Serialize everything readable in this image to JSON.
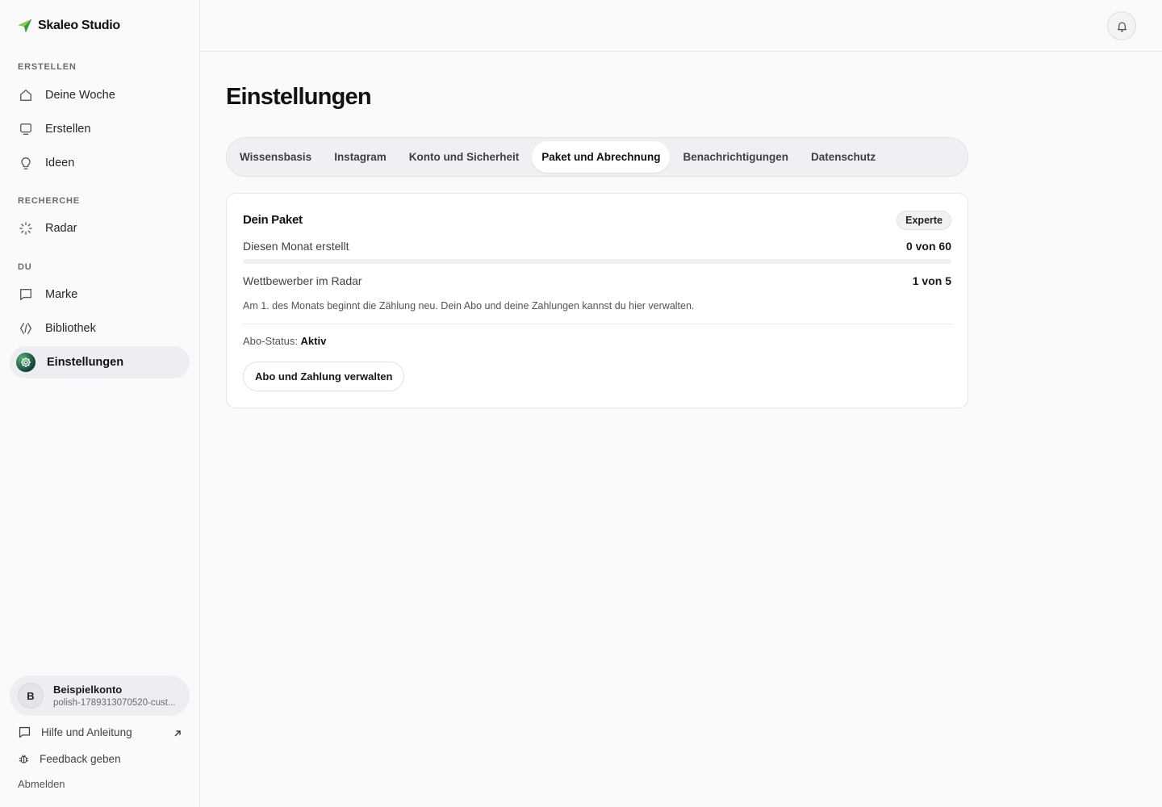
{
  "brand": {
    "name": "Skaleo Studio",
    "logo_icon": "paper-plane-icon",
    "accent_color": "#2b8a57"
  },
  "sidebar": {
    "sections": [
      {
        "label": "ERSTELLEN",
        "items": [
          {
            "label": "Deine Woche",
            "icon": "home-icon"
          },
          {
            "label": "Erstellen",
            "icon": "monitor-icon"
          },
          {
            "label": "Ideen",
            "icon": "lightbulb-icon"
          }
        ]
      },
      {
        "label": "RECHERCHE",
        "items": [
          {
            "label": "Radar",
            "icon": "loader-icon"
          }
        ]
      },
      {
        "label": "DU",
        "items": [
          {
            "label": "Marke",
            "icon": "message-square-icon"
          },
          {
            "label": "Bibliothek",
            "icon": "code-brackets-icon"
          },
          {
            "label": "Einstellungen",
            "icon": "settings-gear-icon",
            "active": true
          }
        ]
      }
    ],
    "account": {
      "initial": "B",
      "name": "Beispielkonto",
      "subtitle": "polish-1789313070520-cust..."
    },
    "help_label": "Hilfe und Anleitung",
    "feedback_label": "Feedback geben",
    "logout_label": "Abmelden"
  },
  "topbar": {
    "notifications_icon": "bell-icon"
  },
  "main": {
    "title": "Einstellungen",
    "tabs": [
      {
        "label": "Wissensbasis"
      },
      {
        "label": "Instagram"
      },
      {
        "label": "Konto und Sicherheit"
      },
      {
        "label": "Paket und Abrechnung",
        "active": true
      },
      {
        "label": "Benachrichtigungen"
      },
      {
        "label": "Datenschutz"
      }
    ],
    "plan_card": {
      "title": "Dein Paket",
      "badge": "Experte",
      "usage_label": "Diesen Monat erstellt",
      "usage_value": "0 von 60",
      "usage_fraction": 0,
      "competitors_label": "Wettbewerber im Radar",
      "competitors_value": "1 von 5",
      "note": "Am 1. des Monats beginnt die Zählung neu. Dein Abo und deine Zahlungen kannst du hier verwalten.",
      "status_label": "Abo-Status:",
      "status_value": "Aktiv",
      "manage_button": "Abo und Zahlung verwalten"
    }
  }
}
